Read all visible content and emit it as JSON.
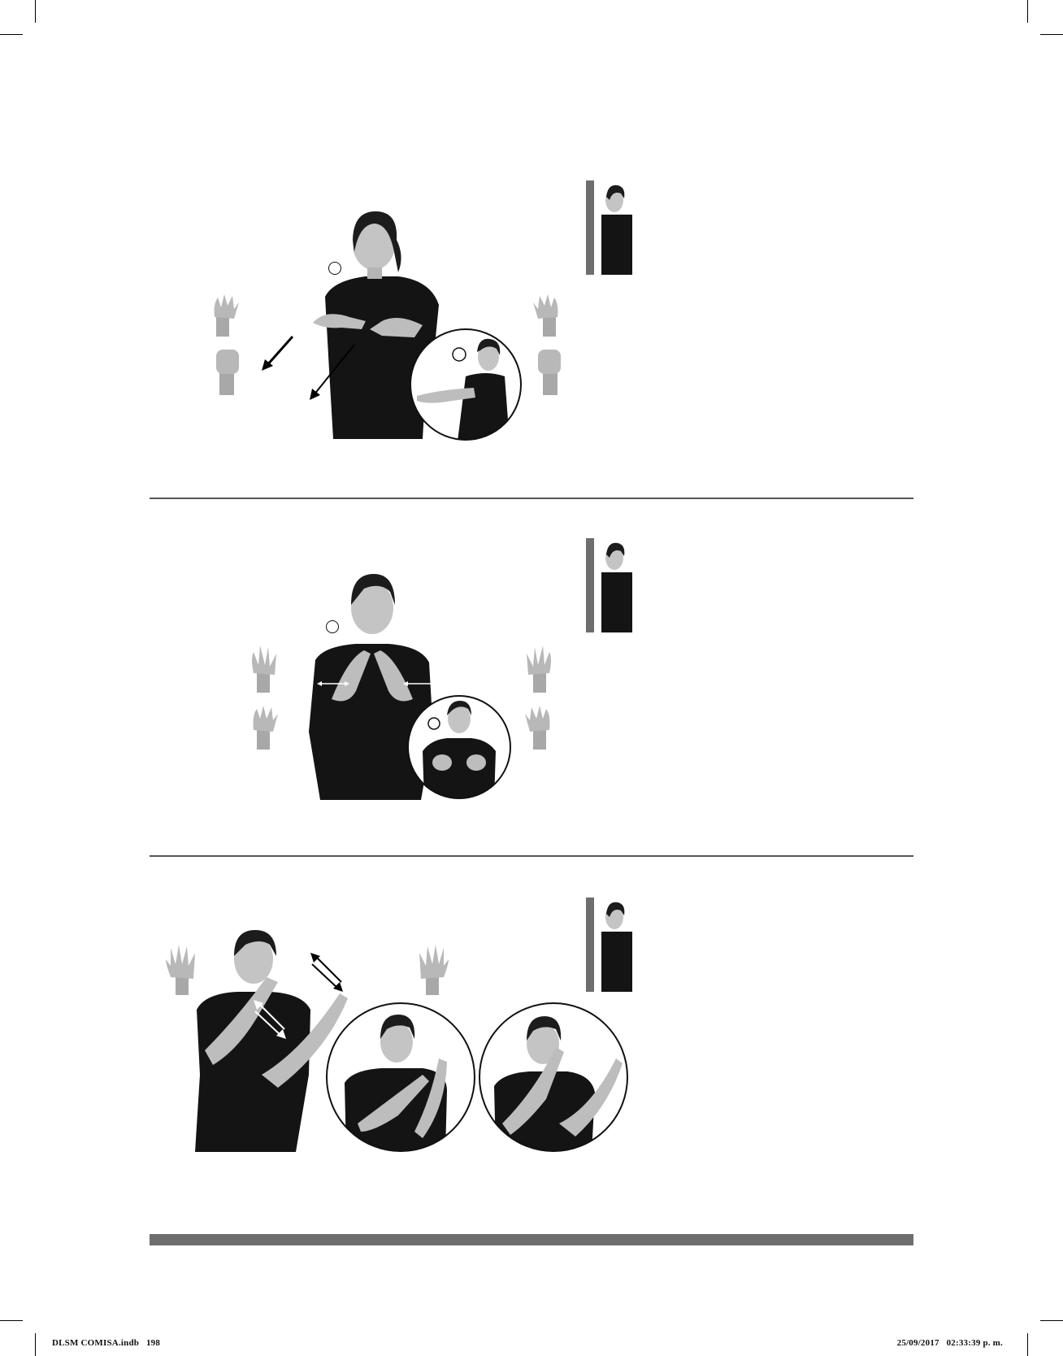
{
  "footer": {
    "file_label": "DLSM COMISA.indb",
    "page_number": "198",
    "timestamp": "25/09/2017   02:33:39 p. m."
  },
  "colors": {
    "rule": "#555555",
    "bar": "#6e6e6e",
    "shirt": "#141414",
    "skin": "#bdbdbd",
    "hair": "#1c1c1c"
  },
  "entries": [
    {
      "id": "entry-1",
      "icons": [
        "claw-hand-icon",
        "fist-hand-icon",
        "profile-figure-icon",
        "arrow-forward-icon"
      ]
    },
    {
      "id": "entry-2",
      "icons": [
        "spread-hand-icon",
        "claw-hand-icon",
        "profile-figure-icon",
        "double-arrow-icon"
      ]
    },
    {
      "id": "entry-3",
      "icons": [
        "open-palm-icon",
        "profile-figure-icon",
        "back-and-forth-arrow-icon"
      ]
    }
  ]
}
